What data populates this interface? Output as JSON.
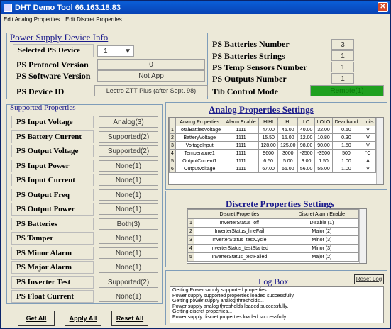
{
  "window": {
    "title": "DHT Demo Tool  66.163.18.83"
  },
  "menu": [
    "Edit Analog Properties",
    "Edit Discret Properties"
  ],
  "power_supply": {
    "section_title": "Power Supply Device Info",
    "selected_label": "Selected PS Device",
    "selected_value": "1",
    "protocol_label": "PS Protocol Version",
    "protocol_value": "0",
    "software_label": "PS Software Version",
    "software_value": "Not App",
    "device_id_label": "PS Device ID",
    "device_id_value": "Lectro ZTT Plus (after Sept. 98)",
    "batteries_number_label": "PS Batteries Number",
    "batteries_number_value": "3",
    "batteries_strings_label": "PS Batteries Strings",
    "batteries_strings_value": "1",
    "temp_sensors_label": "PS Temp Sensors Number",
    "temp_sensors_value": "1",
    "outputs_label": "PS Outputs Number",
    "outputs_value": "1",
    "tib_label": "Tib Control Mode",
    "tib_value": "Remote(1)",
    "tib_color": "#1fa01f"
  },
  "supported": {
    "section_title": "Supported Properties",
    "items": [
      {
        "label": "PS Input Voltage",
        "value": "Analog(3)"
      },
      {
        "label": "PS Battery Current",
        "value": "Supported(2)"
      },
      {
        "label": "PS Output Voltage",
        "value": "Supported(2)"
      },
      {
        "label": "PS Input Power",
        "value": "None(1)"
      },
      {
        "label": "PS Input Current",
        "value": "None(1)"
      },
      {
        "label": "PS Output Freq",
        "value": "None(1)"
      },
      {
        "label": "PS Output Power",
        "value": "None(1)"
      },
      {
        "label": "PS Batteries",
        "value": "Both(3)"
      },
      {
        "label": "PS Tamper",
        "value": "None(1)"
      },
      {
        "label": "PS Minor Alarm",
        "value": "None(1)"
      },
      {
        "label": "PS Major Alarm",
        "value": "None(1)"
      },
      {
        "label": "PS Inverter Test",
        "value": "Supported(2)"
      },
      {
        "label": "PS Float Current",
        "value": "None(1)"
      }
    ]
  },
  "analog": {
    "section_title": "Analog Properties Settings",
    "headers": [
      "",
      "Analog Properties",
      "Alarm Enable",
      "HIHI",
      "HI",
      "LO",
      "LOLO",
      "Deadband",
      "Units"
    ],
    "rows": [
      [
        "1",
        "TotalBattiesVoltage",
        "1111",
        "47.00",
        "45.00",
        "40.00",
        "32.00",
        "0.50",
        "V"
      ],
      [
        "2",
        "BatteryVoltage",
        "1111",
        "15.50",
        "15.00",
        "12.00",
        "10.80",
        "0.30",
        "V"
      ],
      [
        "3",
        "VoltageInput",
        "1111",
        "128.00",
        "125.00",
        "98.00",
        "90.00",
        "1.50",
        "V"
      ],
      [
        "4",
        "Temperature1",
        "1111",
        "9600",
        "3000",
        "-2500",
        "-3500",
        "500",
        "°C"
      ],
      [
        "5",
        "OutputCurrent1",
        "1111",
        "6.50",
        "5.00",
        "3.00",
        "1.50",
        "1.00",
        "A"
      ],
      [
        "6",
        "OutputVoltage",
        "1111",
        "67.00",
        "65.00",
        "56.00",
        "55.00",
        "1.00",
        "V"
      ]
    ]
  },
  "discrete": {
    "section_title": "Discrete Properties Settings",
    "headers": [
      "",
      "Discret Properties",
      "Discret Alarm Enable"
    ],
    "rows": [
      [
        "1",
        "InverterStatus_off",
        "Disable (1)"
      ],
      [
        "2",
        "InverterStatus_lineFail",
        "Major (2)"
      ],
      [
        "3",
        "InverterStatus_testCycle",
        "Minor (3)"
      ],
      [
        "4",
        "InverterStatus_testStarted",
        "Minor (3)"
      ],
      [
        "5",
        "InverterStatus_testFailed",
        "Major (2)"
      ]
    ]
  },
  "logbox": {
    "title": "Log Box",
    "reset_label": "Reset Log",
    "lines": [
      "Getting Power supply supported properties...",
      "Power supply supported properties loaded successfully.",
      "Getting power supply analog thresholds...",
      "Power supply analog thresholds loaded successfully.",
      "Getting discret properties...",
      "Power supply discret properties loaded successfully."
    ]
  },
  "buttons": {
    "get_all": "Get All",
    "apply_all": "Apply All",
    "reset_all": "Reset All"
  }
}
